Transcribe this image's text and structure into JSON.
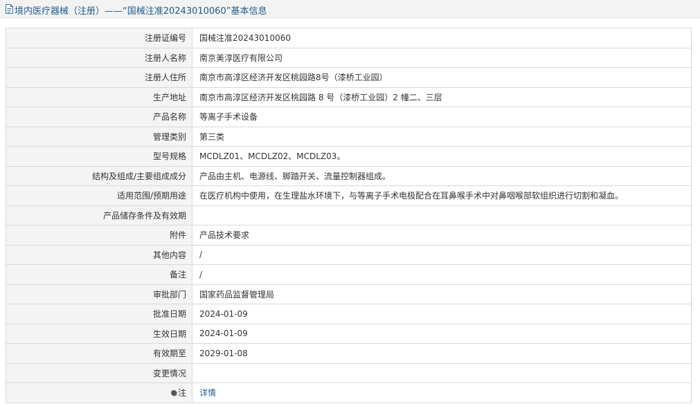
{
  "header": {
    "title": "境内医疗器械（注册）——“国械注准20243010060”基本信息",
    "icon": "document-icon"
  },
  "rows": [
    {
      "label": "注册证编号",
      "value": "国械注准20243010060"
    },
    {
      "label": "注册人名称",
      "value": "南京美淳医疗有限公司"
    },
    {
      "label": "注册人住所",
      "value": "南京市高淳区经济开发区桃园路8号（漆桥工业园）"
    },
    {
      "label": "生产地址",
      "value": "南京市高淳区经济开发区桃园路 8 号（漆桥工业园）2 幢二、三层"
    },
    {
      "label": "产品名称",
      "value": "等离子手术设备"
    },
    {
      "label": "管理类别",
      "value": "第三类"
    },
    {
      "label": "型号规格",
      "value": "MCDLZ01、MCDLZ02、MCDLZ03。"
    },
    {
      "label": "结构及组成/主要组成成分",
      "value": "产品由主机、电源线、脚踏开关、流量控制器组成。"
    },
    {
      "label": "适用范围/预期用途",
      "value": "在医疗机构中使用，在生理盐水环境下，与等离子手术电极配合在耳鼻喉手术中对鼻咽喉部软组织进行切割和凝血。"
    },
    {
      "label": "产品储存条件及有效期",
      "value": ""
    },
    {
      "label": "附件",
      "value": "产品技术要求"
    },
    {
      "label": "其他内容",
      "value": "/"
    },
    {
      "label": "备注",
      "value": "/"
    },
    {
      "label": "审批部门",
      "value": "国家药品监督管理局"
    },
    {
      "label": "批准日期",
      "value": "2024-01-09"
    },
    {
      "label": "生效日期",
      "value": "2024-01-09"
    },
    {
      "label": "有效期至",
      "value": "2029-01-08"
    },
    {
      "label": "变更情况",
      "value": ""
    }
  ],
  "note": {
    "label": "注",
    "link": "详情"
  }
}
